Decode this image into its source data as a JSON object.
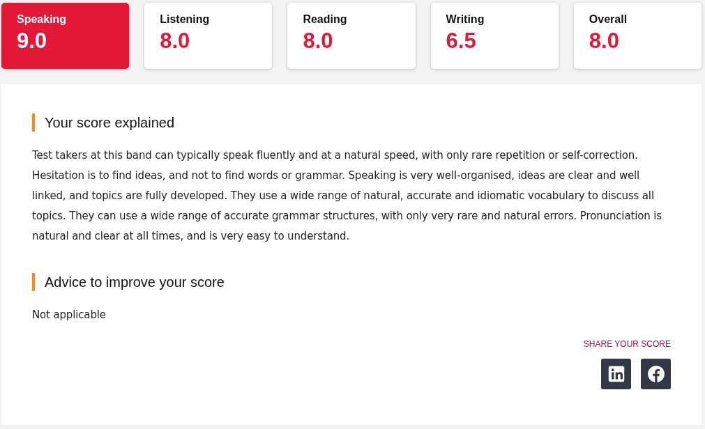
{
  "score_cards": [
    {
      "label": "Speaking",
      "score": "9.0",
      "selected": true
    },
    {
      "label": "Listening",
      "score": "8.0",
      "selected": false
    },
    {
      "label": "Reading",
      "score": "8.0",
      "selected": false
    },
    {
      "label": "Writing",
      "score": "6.5",
      "selected": false
    },
    {
      "label": "Overall",
      "score": "8.0",
      "selected": false
    }
  ],
  "sections": [
    {
      "heading": "Your score explained",
      "body": "Test takers at this band can typically speak fluently and at a natural speed, with only rare repetition or self-correction. Hesitation is to find ideas, and not to find words or grammar. Speaking is very well-organised, ideas are clear and well linked, and topics are fully developed. They use a wide range of natural, accurate and idiomatic vocabulary to discuss all topics. They can use a wide range of accurate grammar structures, with only very rare and natural errors. Pronunciation is natural and clear at all times, and is very easy to understand."
    },
    {
      "heading": "Advice to improve your score",
      "body": "Not applicable"
    }
  ],
  "share": {
    "label": "SHARE YOUR SCORE",
    "buttons": [
      {
        "kind": "linkedin"
      },
      {
        "kind": "facebook"
      }
    ]
  }
}
